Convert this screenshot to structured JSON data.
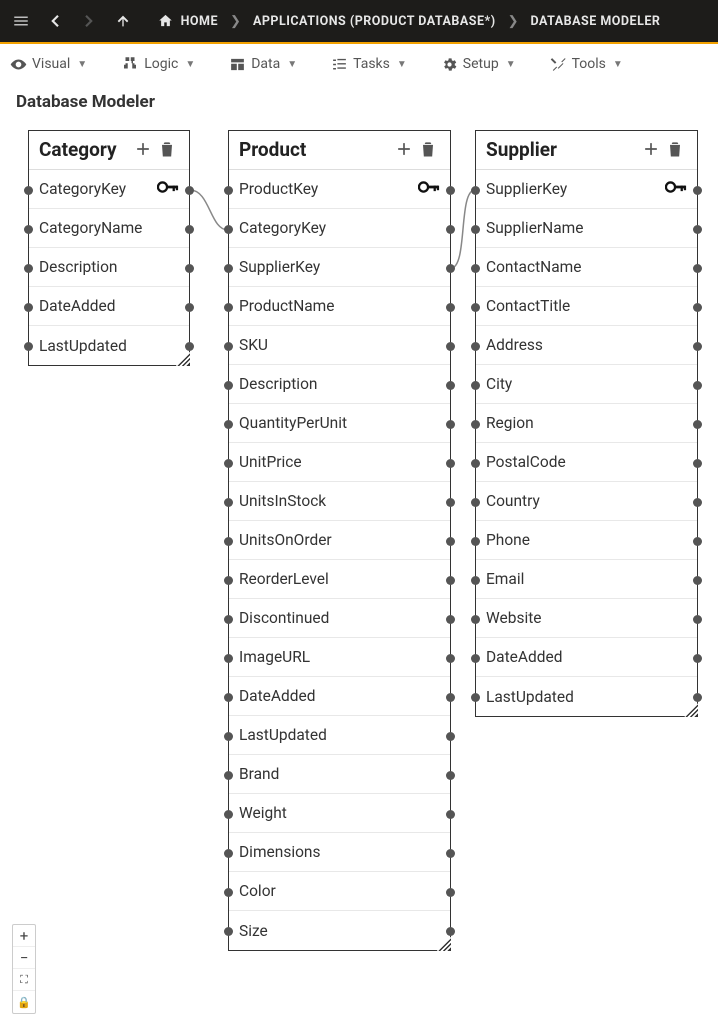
{
  "topbar": {
    "breadcrumb_home": "HOME",
    "breadcrumb_apps": "APPLICATIONS (PRODUCT DATABASE*)",
    "breadcrumb_leaf": "DATABASE MODELER"
  },
  "toolbar": {
    "visual": "Visual",
    "logic": "Logic",
    "data": "Data",
    "tasks": "Tasks",
    "setup": "Setup",
    "tools": "Tools"
  },
  "page_title": "Database Modeler",
  "tables": {
    "category": {
      "name": "Category",
      "fields": [
        {
          "name": "CategoryKey",
          "pk": true
        },
        {
          "name": "CategoryName"
        },
        {
          "name": "Description"
        },
        {
          "name": "DateAdded"
        },
        {
          "name": "LastUpdated"
        }
      ]
    },
    "product": {
      "name": "Product",
      "fields": [
        {
          "name": "ProductKey",
          "pk": true
        },
        {
          "name": "CategoryKey"
        },
        {
          "name": "SupplierKey"
        },
        {
          "name": "ProductName"
        },
        {
          "name": "SKU"
        },
        {
          "name": "Description"
        },
        {
          "name": "QuantityPerUnit"
        },
        {
          "name": "UnitPrice"
        },
        {
          "name": "UnitsInStock"
        },
        {
          "name": "UnitsOnOrder"
        },
        {
          "name": "ReorderLevel"
        },
        {
          "name": "Discontinued"
        },
        {
          "name": "ImageURL"
        },
        {
          "name": "DateAdded"
        },
        {
          "name": "LastUpdated"
        },
        {
          "name": "Brand"
        },
        {
          "name": "Weight"
        },
        {
          "name": "Dimensions"
        },
        {
          "name": "Color"
        },
        {
          "name": "Size"
        }
      ]
    },
    "supplier": {
      "name": "Supplier",
      "fields": [
        {
          "name": "SupplierKey",
          "pk": true
        },
        {
          "name": "SupplierName"
        },
        {
          "name": "ContactName"
        },
        {
          "name": "ContactTitle"
        },
        {
          "name": "Address"
        },
        {
          "name": "City"
        },
        {
          "name": "Region"
        },
        {
          "name": "PostalCode"
        },
        {
          "name": "Country"
        },
        {
          "name": "Phone"
        },
        {
          "name": "Email"
        },
        {
          "name": "Website"
        },
        {
          "name": "DateAdded"
        },
        {
          "name": "LastUpdated"
        }
      ]
    }
  },
  "relationships": [
    {
      "from": "category.CategoryKey",
      "to": "product.CategoryKey"
    },
    {
      "from": "supplier.SupplierKey",
      "to": "product.SupplierKey"
    }
  ],
  "zoom": {
    "plus": "+",
    "minus": "−",
    "fit": "⛶",
    "lock": "🔒"
  }
}
